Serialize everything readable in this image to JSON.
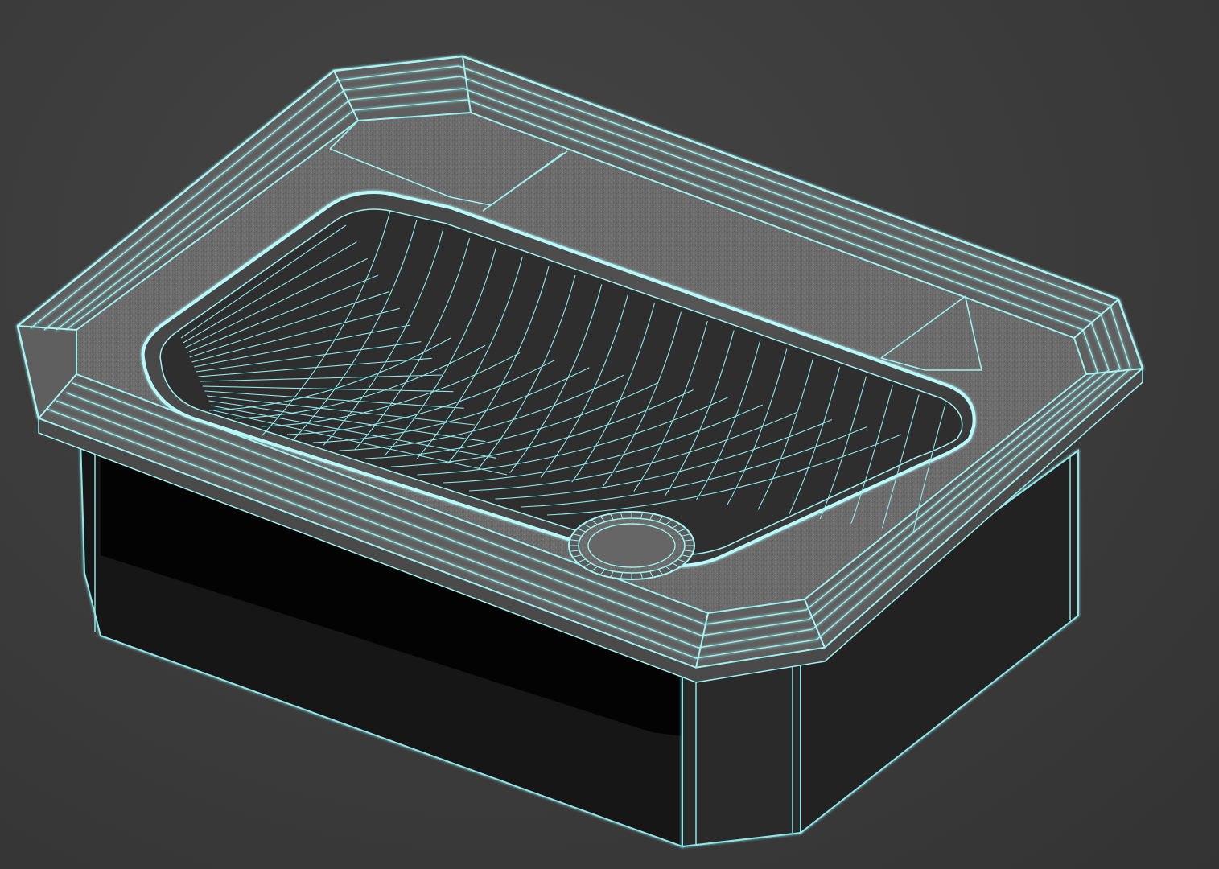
{
  "viewport": {
    "shading_mode": "wireframe-over-shaded",
    "background_color": "#3b3b3b",
    "wire_color": "#9ff0f0",
    "wire_glow_color": "#5fd8dc",
    "surface_color": "#6e6e6e",
    "surface_dark_color": "#4e4e4e",
    "shadow_color": "#050505"
  },
  "model": {
    "object": "sink-basin",
    "parts": [
      "rim-frame",
      "basin-bowl",
      "drain",
      "pedestal-base",
      "faucet-deck-panels"
    ]
  }
}
